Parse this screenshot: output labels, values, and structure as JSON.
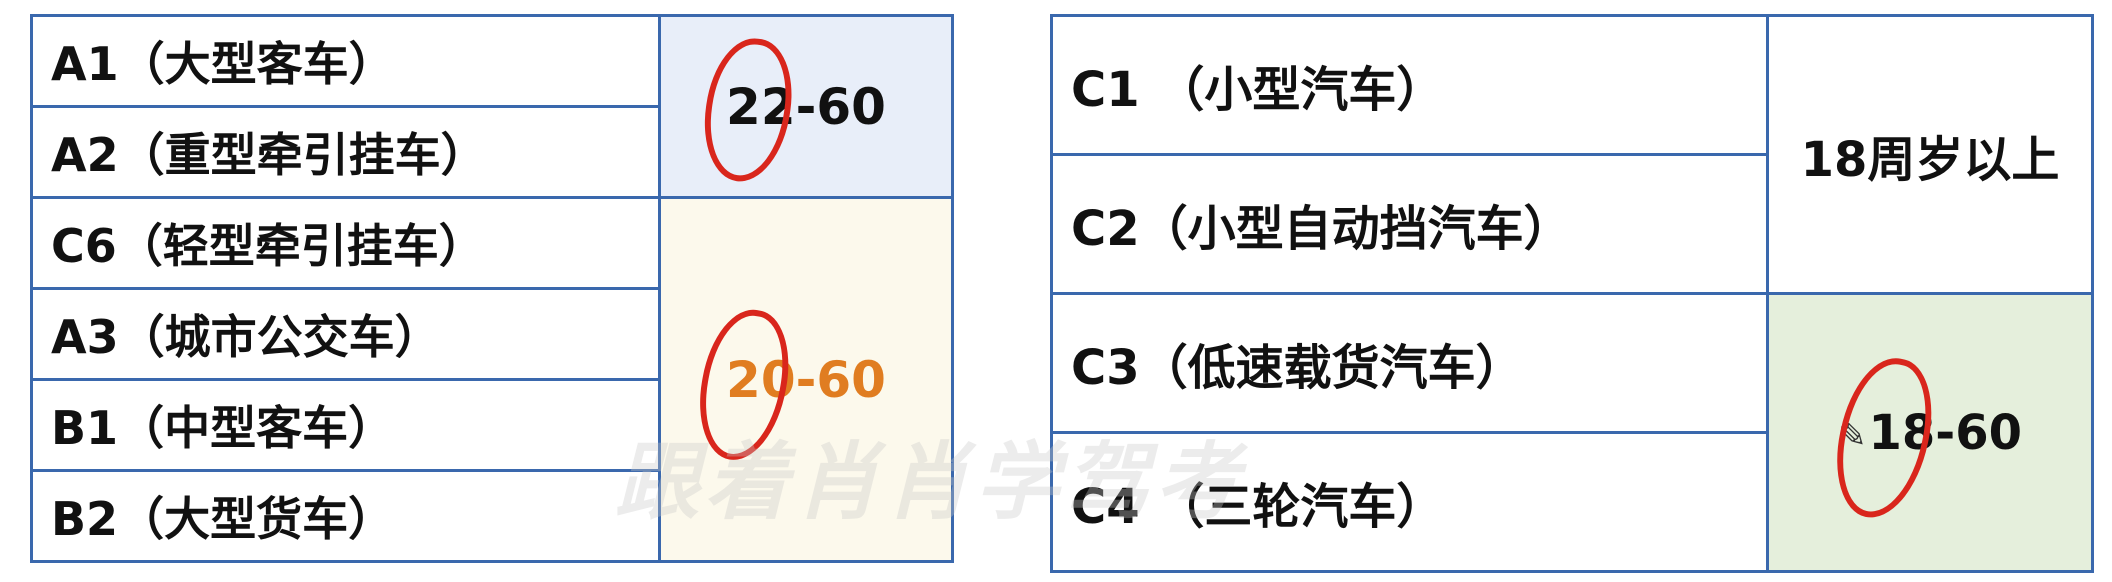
{
  "left_table": {
    "rows": [
      {
        "code": "A1",
        "name": "（大型客车）"
      },
      {
        "code": "A2",
        "name": "（重型牵引挂车）"
      },
      {
        "code": "C6",
        "name": "（轻型牵引挂车）"
      },
      {
        "code": "A3",
        "name": "（城市公交车）"
      },
      {
        "code": "B1",
        "name": "（中型客车）"
      },
      {
        "code": "B2",
        "name": "（大型货车）"
      }
    ],
    "age_ranges": [
      {
        "value": "22-60",
        "background": "#e8eef9",
        "text_color": "#111111",
        "circled": true
      },
      {
        "value": "20-60",
        "background": "#fcf9ec",
        "text_color": "#e07d21",
        "circled": true
      }
    ]
  },
  "right_table": {
    "rows": [
      {
        "code": "C1",
        "name": " （小型汽车）"
      },
      {
        "code": "C2",
        "name": "（小型自动挡汽车）"
      },
      {
        "code": "C3",
        "name": "（低速载货汽车）"
      },
      {
        "code": "C4",
        "name": " （三轮汽车）"
      }
    ],
    "age_ranges": [
      {
        "value": "18周岁以上",
        "background": "#ffffff",
        "text_color": "#111111",
        "circled": false
      },
      {
        "value": "18-60",
        "background": "#e5efdc",
        "text_color": "#111111",
        "circled": true,
        "icon": "pencil-icon"
      }
    ]
  },
  "watermark": "跟着肖肖学驾考",
  "colors": {
    "border": "#3a68ad",
    "annotation_red": "#d9261c"
  }
}
